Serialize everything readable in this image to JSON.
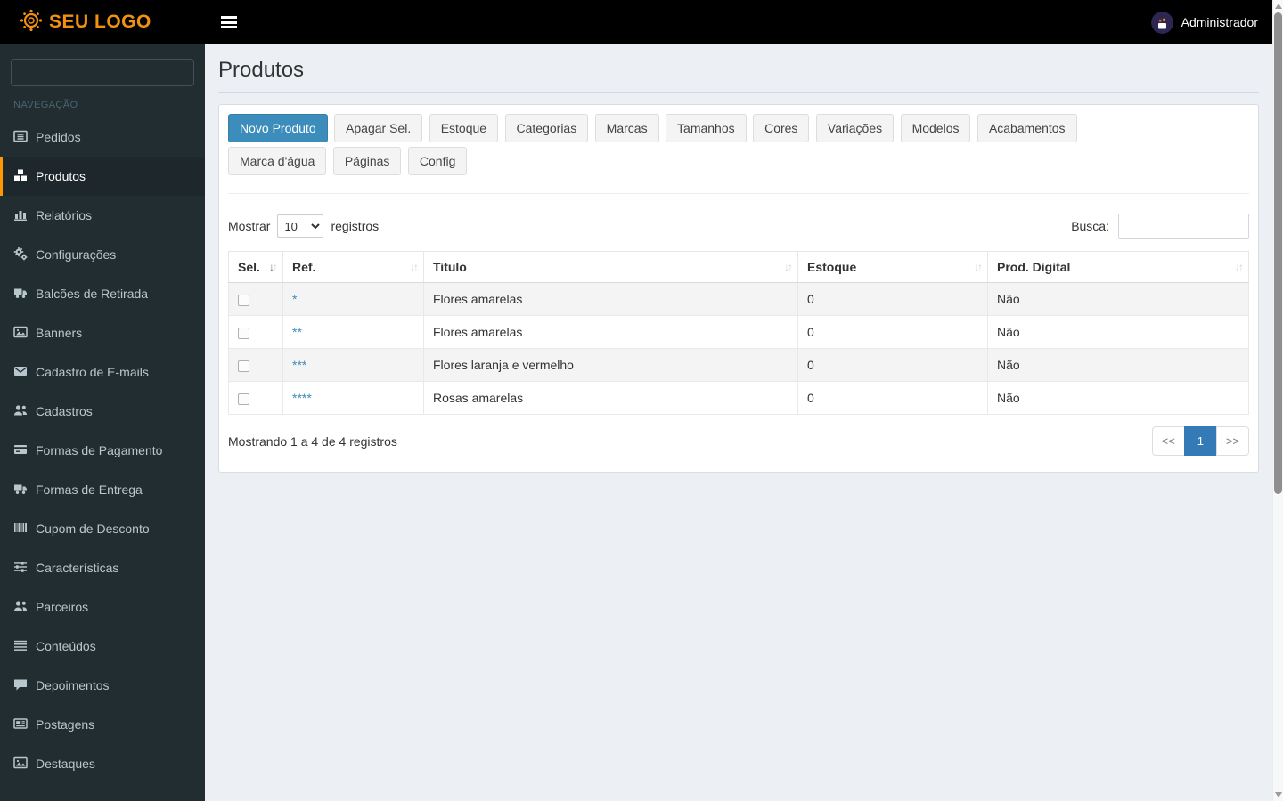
{
  "topbar": {
    "logo_text": "SEU LOGO",
    "user_name": "Administrador"
  },
  "sidebar": {
    "search_value": "",
    "section_label": "NAVEGAÇÃO",
    "items": [
      {
        "label": "Pedidos",
        "icon": "list-alt"
      },
      {
        "label": "Produtos",
        "icon": "cubes",
        "active": true
      },
      {
        "label": "Relatórios",
        "icon": "bar-chart"
      },
      {
        "label": "Configurações",
        "icon": "gears"
      },
      {
        "label": "Balcões de Retirada",
        "icon": "truck"
      },
      {
        "label": "Banners",
        "icon": "image"
      },
      {
        "label": "Cadastro de E-mails",
        "icon": "envelope"
      },
      {
        "label": "Cadastros",
        "icon": "users"
      },
      {
        "label": "Formas de Pagamento",
        "icon": "credit-card"
      },
      {
        "label": "Formas de Entrega",
        "icon": "truck"
      },
      {
        "label": "Cupom de Desconto",
        "icon": "barcode"
      },
      {
        "label": "Características",
        "icon": "sliders"
      },
      {
        "label": "Parceiros",
        "icon": "users"
      },
      {
        "label": "Conteúdos",
        "icon": "list"
      },
      {
        "label": "Depoimentos",
        "icon": "comment"
      },
      {
        "label": "Postagens",
        "icon": "newspaper"
      },
      {
        "label": "Destaques",
        "icon": "image"
      }
    ]
  },
  "page": {
    "title": "Produtos"
  },
  "toolbar": {
    "row1": [
      "Novo Produto",
      "Apagar Sel.",
      "Estoque",
      "Categorias",
      "Marcas",
      "Tamanhos",
      "Cores",
      "Variações",
      "Modelos",
      "Acabamentos"
    ],
    "row2": [
      "Marca d'água",
      "Páginas",
      "Config"
    ]
  },
  "table": {
    "length_label_before": "Mostrar",
    "length_value": "10",
    "length_label_after": "registros",
    "search_label": "Busca:",
    "search_value": "",
    "columns": [
      "Sel.",
      "Ref.",
      "Titulo",
      "Estoque",
      "Prod. Digital"
    ],
    "rows": [
      {
        "ref": "*",
        "titulo": "Flores amarelas",
        "estoque": "0",
        "digital": "Não"
      },
      {
        "ref": "**",
        "titulo": "Flores amarelas",
        "estoque": "0",
        "digital": "Não"
      },
      {
        "ref": "***",
        "titulo": "Flores laranja e vermelho",
        "estoque": "0",
        "digital": "Não"
      },
      {
        "ref": "****",
        "titulo": "Rosas amarelas",
        "estoque": "0",
        "digital": "Não"
      }
    ],
    "info": "Mostrando 1 a 4 de 4 registros",
    "pagination": {
      "prev": "<<",
      "page": "1",
      "next": ">>"
    }
  },
  "colors": {
    "topbar_bg": "#000000",
    "logo_orange": "#f29111",
    "sidebar_bg": "#222d32",
    "sidebar_active_bg": "#1e282c",
    "sidebar_active_border": "#ff9800",
    "sidebar_text": "#b8c7ce",
    "primary_button_blue": "#3c8dbc",
    "pagination_active_blue": "#337ab7",
    "content_bg": "#ecf0f5",
    "link_blue": "#3c8dbc"
  }
}
